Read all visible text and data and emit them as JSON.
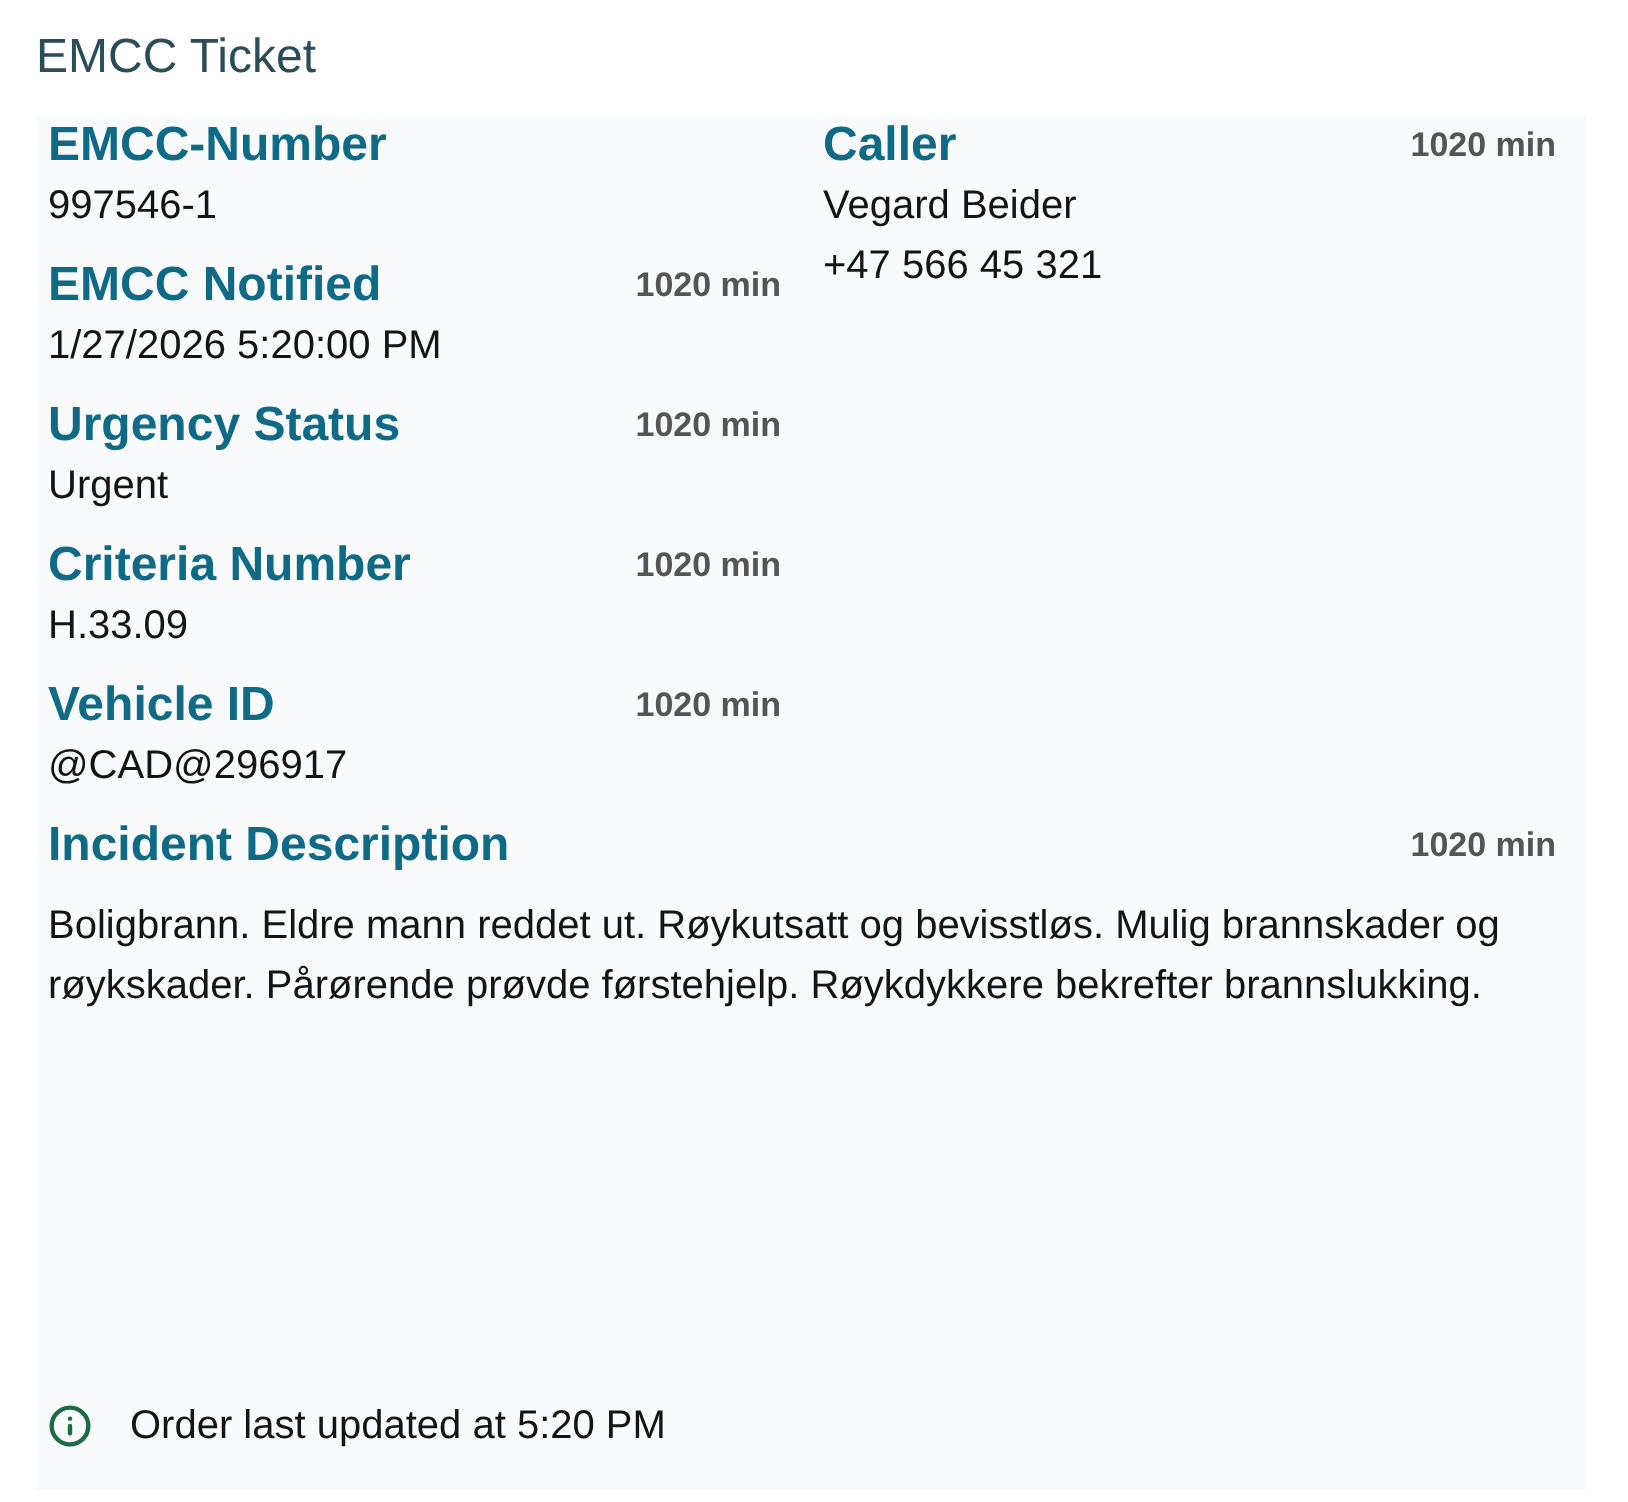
{
  "title": "EMCC Ticket",
  "left_fields": [
    {
      "label": "EMCC-Number",
      "values": [
        "997546-1"
      ]
    },
    {
      "label": "EMCC Notified",
      "time": "1020 min",
      "values": [
        "1/27/2026 5:20:00 PM"
      ]
    },
    {
      "label": "Urgency Status",
      "time": "1020 min",
      "values": [
        "Urgent"
      ]
    },
    {
      "label": "Criteria Number",
      "time": "1020 min",
      "values": [
        "H.33.09"
      ]
    },
    {
      "label": "Vehicle ID",
      "time": "1020 min",
      "values": [
        "@CAD@296917"
      ]
    }
  ],
  "right_fields": [
    {
      "label": "Caller",
      "time": "1020 min",
      "values": [
        "Vegard Beider",
        "+47 566 45 321"
      ]
    }
  ],
  "description": {
    "label": "Incident Description",
    "time": "1020 min",
    "text": "Boligbrann. Eldre mann reddet ut. Røykutsatt og bevisstløs. Mulig brannskader og røykskader. Pårørende prøvde førstehjelp. Røykdykkere bekrefter brannslukking."
  },
  "footer": {
    "text": "Order last updated at 5:20 PM"
  }
}
